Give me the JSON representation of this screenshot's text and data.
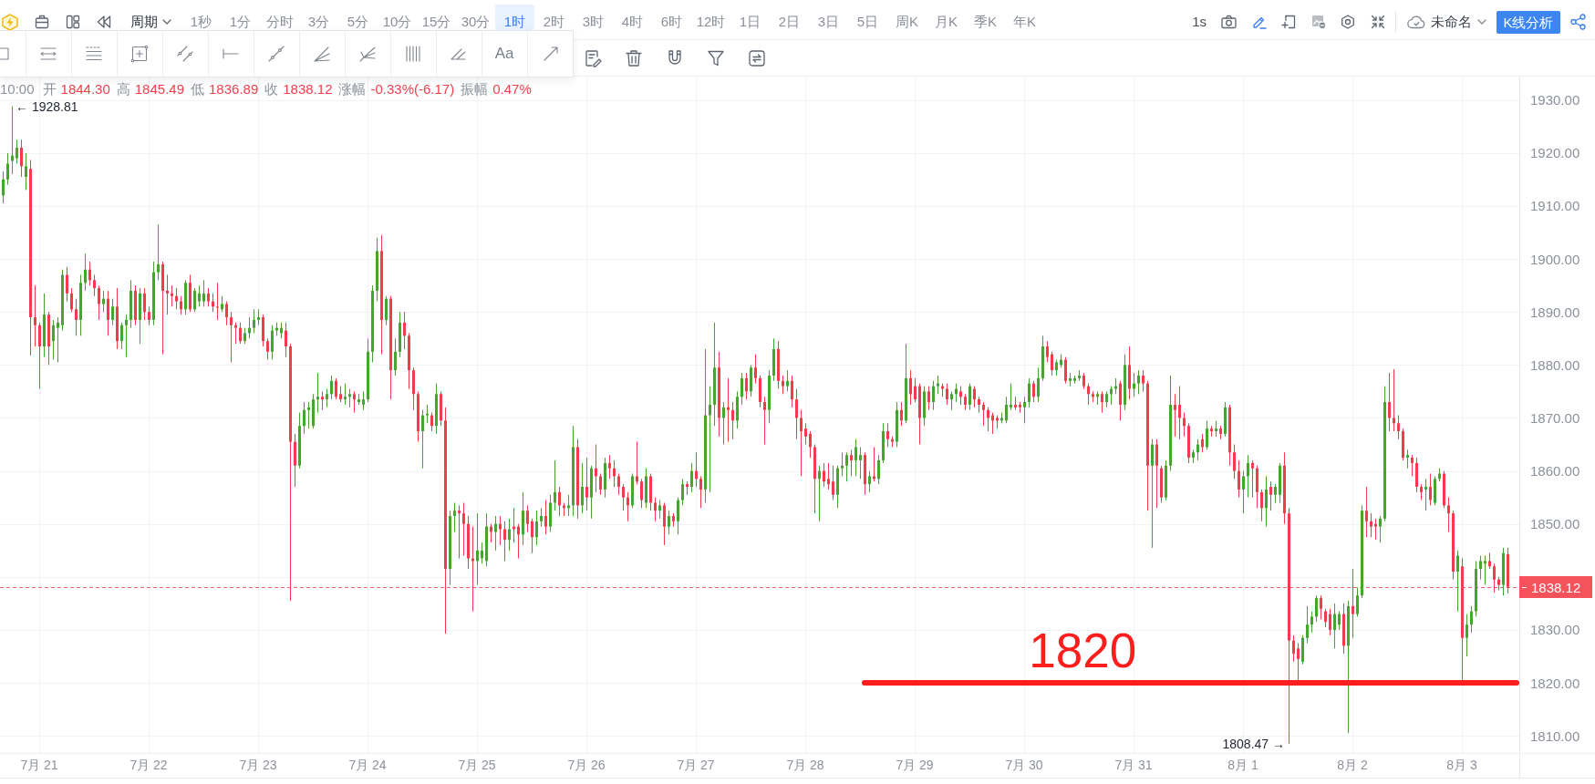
{
  "toolbar": {
    "period_menu": {
      "label": "周期"
    },
    "intervals": [
      {
        "label": "1秒",
        "selected": false
      },
      {
        "label": "1分",
        "selected": false
      },
      {
        "label": "分时",
        "selected": false
      },
      {
        "label": "3分",
        "selected": false
      },
      {
        "label": "5分",
        "selected": false
      },
      {
        "label": "10分",
        "selected": false
      },
      {
        "label": "15分",
        "selected": false
      },
      {
        "label": "30分",
        "selected": false
      },
      {
        "label": "1时",
        "selected": true
      },
      {
        "label": "2时",
        "selected": false
      },
      {
        "label": "3时",
        "selected": false
      },
      {
        "label": "4时",
        "selected": false
      },
      {
        "label": "6时",
        "selected": false
      },
      {
        "label": "12时",
        "selected": false
      },
      {
        "label": "1日",
        "selected": false
      },
      {
        "label": "2日",
        "selected": false
      },
      {
        "label": "3日",
        "selected": false
      },
      {
        "label": "5日",
        "selected": false
      },
      {
        "label": "周K",
        "selected": false
      },
      {
        "label": "月K",
        "selected": false
      },
      {
        "label": "季K",
        "selected": false
      },
      {
        "label": "年K",
        "selected": false
      }
    ],
    "refresh_rate": "1s",
    "tools": [
      {
        "active": false
      },
      {
        "active": true
      },
      {
        "active": false
      },
      {
        "active": false
      },
      {
        "active": false
      },
      {
        "active": false
      }
    ],
    "layout_name": "未命名",
    "analysis_button": "K线分析"
  },
  "drawing_toolbar": {
    "text_tool": "Aa"
  },
  "chart": {
    "header": {
      "time": "10:00",
      "fields": [
        {
          "label": "开",
          "value": "1844.30"
        },
        {
          "label": "高",
          "value": "1845.49"
        },
        {
          "label": "低",
          "value": "1836.89"
        },
        {
          "label": "收",
          "value": "1838.12"
        },
        {
          "label": "涨幅",
          "value": "-0.33%(-6.17)"
        },
        {
          "label": "振幅",
          "value": "0.47%"
        }
      ]
    },
    "chart_data": {
      "type": "candlestick",
      "grid": true,
      "ylim": [
        1806.77,
        1934.42
      ],
      "yticks": [
        {
          "value": 1930,
          "label": "1930.00"
        },
        {
          "value": 1920,
          "label": "1920.00"
        },
        {
          "value": 1910,
          "label": "1910.00"
        },
        {
          "value": 1900,
          "label": "1900.00"
        },
        {
          "value": 1890,
          "label": "1890.00"
        },
        {
          "value": 1880,
          "label": "1880.00"
        },
        {
          "value": 1870,
          "label": "1870.00"
        },
        {
          "value": 1860,
          "label": "1860.00"
        },
        {
          "value": 1850,
          "label": "1850.00"
        },
        {
          "value": 1830,
          "label": "1830.00"
        },
        {
          "value": 1820,
          "label": "1820.00"
        },
        {
          "value": 1810,
          "label": "1810.00"
        }
      ],
      "categories": [
        null,
        null,
        null,
        null,
        null,
        null,
        null,
        null,
        "7月 21",
        null,
        null,
        null,
        null,
        null,
        null,
        null,
        null,
        null,
        null,
        null,
        null,
        null,
        null,
        null,
        null,
        null,
        null,
        null,
        null,
        null,
        null,
        null,
        "7月 22",
        null,
        null,
        null,
        null,
        null,
        null,
        null,
        null,
        null,
        null,
        null,
        null,
        null,
        null,
        null,
        null,
        null,
        null,
        null,
        null,
        null,
        null,
        null,
        "7月 23",
        null,
        null,
        null,
        null,
        null,
        null,
        null,
        null,
        null,
        null,
        null,
        null,
        null,
        null,
        null,
        null,
        null,
        null,
        null,
        null,
        null,
        null,
        null,
        "7月 24",
        null,
        null,
        null,
        null,
        null,
        null,
        null,
        null,
        null,
        null,
        null,
        null,
        null,
        null,
        null,
        null,
        null,
        null,
        null,
        null,
        null,
        null,
        null,
        "7月 25",
        null,
        null,
        null,
        null,
        null,
        null,
        null,
        null,
        null,
        null,
        null,
        null,
        null,
        null,
        null,
        null,
        null,
        null,
        null,
        null,
        null,
        null,
        null,
        "7月 26",
        null,
        null,
        null,
        null,
        null,
        null,
        null,
        null,
        null,
        null,
        null,
        null,
        null,
        null,
        null,
        null,
        null,
        null,
        null,
        null,
        null,
        null,
        null,
        "7月 27",
        null,
        null,
        null,
        null,
        null,
        null,
        null,
        null,
        null,
        null,
        null,
        null,
        null,
        null,
        null,
        null,
        null,
        null,
        null,
        null,
        null,
        null,
        null,
        "7月 28",
        null,
        null,
        null,
        null,
        null,
        null,
        null,
        null,
        null,
        null,
        null,
        null,
        null,
        null,
        null,
        null,
        null,
        null,
        null,
        null,
        null,
        null,
        null,
        "7月 29",
        null,
        null,
        null,
        null,
        null,
        null,
        null,
        null,
        null,
        null,
        null,
        null,
        null,
        null,
        null,
        null,
        null,
        null,
        null,
        null,
        null,
        null,
        null,
        "7月 30",
        null,
        null,
        null,
        null,
        null,
        null,
        null,
        null,
        null,
        null,
        null,
        null,
        null,
        null,
        null,
        null,
        null,
        null,
        null,
        null,
        null,
        null,
        null,
        "7月 31",
        null,
        null,
        null,
        null,
        null,
        null,
        null,
        null,
        null,
        null,
        null,
        null,
        null,
        null,
        null,
        null,
        null,
        null,
        null,
        null,
        null,
        null,
        null,
        "8月 1",
        null,
        null,
        null,
        null,
        null,
        null,
        null,
        null,
        null,
        null,
        null,
        null,
        null,
        null,
        null,
        null,
        null,
        null,
        null,
        null,
        null,
        null,
        null,
        "8月 2",
        null,
        null,
        null,
        null,
        null,
        null,
        null,
        null,
        null,
        null,
        null,
        null,
        null,
        null,
        null,
        null,
        null,
        null,
        null,
        null,
        null,
        null,
        null,
        "8月 3",
        null,
        null,
        null,
        null,
        null,
        null,
        null,
        null,
        null,
        null
      ],
      "ohlc": [
        [
          1912,
          1916.5,
          1910.5,
          1915
        ],
        [
          1915,
          1920,
          1914,
          1918
        ],
        [
          1918.5,
          1928.81,
          1916,
          1919.5
        ],
        [
          1919,
          1922.5,
          1918,
          1921
        ],
        [
          1921,
          1922.5,
          1915.5,
          1917.5
        ],
        [
          1915.5,
          1920,
          1913,
          1917.5
        ],
        [
          1917,
          1918.7,
          1881.8,
          1889
        ],
        [
          1889,
          1895,
          1883.5,
          1887.5
        ],
        [
          1887.5,
          1888,
          1875.5,
          1883.5
        ],
        [
          1883.5,
          1893.5,
          1881.5,
          1889.5
        ],
        [
          1889.5,
          1890,
          1880,
          1883.5
        ],
        [
          1884.5,
          1888.5,
          1881,
          1887.5
        ],
        [
          1887,
          1889,
          1880.5,
          1888
        ],
        [
          1887.5,
          1898,
          1886.5,
          1897
        ],
        [
          1897,
          1898.5,
          1892,
          1893.5
        ],
        [
          1893.5,
          1894.5,
          1890,
          1890.5
        ],
        [
          1890.5,
          1892.5,
          1885.5,
          1888.5
        ],
        [
          1888.5,
          1897,
          1885.5,
          1895.5
        ],
        [
          1895.5,
          1901,
          1894,
          1898
        ],
        [
          1898,
          1899.5,
          1895,
          1896
        ],
        [
          1896,
          1897,
          1893,
          1894.5
        ],
        [
          1894.5,
          1895,
          1888.5,
          1891.5
        ],
        [
          1891.5,
          1894,
          1890,
          1892.5
        ],
        [
          1892.5,
          1894,
          1885.5,
          1888.5
        ],
        [
          1888.5,
          1892.5,
          1887.5,
          1891
        ],
        [
          1891,
          1894.5,
          1883,
          1884.5
        ],
        [
          1884.5,
          1888,
          1883,
          1887.5
        ],
        [
          1887.5,
          1889.5,
          1881.5,
          1888.5
        ],
        [
          1888.5,
          1896,
          1887,
          1894
        ],
        [
          1894,
          1895,
          1887.5,
          1888.5
        ],
        [
          1888.5,
          1894.5,
          1884,
          1893.5
        ],
        [
          1893.5,
          1894.5,
          1888.5,
          1890
        ],
        [
          1890,
          1891,
          1887.5,
          1888.5
        ],
        [
          1888.5,
          1899.5,
          1887.5,
          1897.5
        ],
        [
          1897.5,
          1906.5,
          1896,
          1899
        ],
        [
          1899,
          1899.5,
          1882,
          1894
        ],
        [
          1894,
          1897,
          1889.5,
          1893.5
        ],
        [
          1893.5,
          1895,
          1891,
          1893
        ],
        [
          1893,
          1894.5,
          1890.5,
          1892
        ],
        [
          1892,
          1893,
          1889.5,
          1890.5
        ],
        [
          1890.5,
          1896,
          1889.5,
          1895.5
        ],
        [
          1895.5,
          1897,
          1890,
          1890.5
        ],
        [
          1890.5,
          1894.5,
          1890,
          1894
        ],
        [
          1892,
          1895,
          1891,
          1893.5
        ],
        [
          1892,
          1896,
          1891,
          1893.5
        ],
        [
          1893.5,
          1894.5,
          1891,
          1892
        ],
        [
          1892,
          1893.5,
          1890,
          1891
        ],
        [
          1891,
          1895.5,
          1888.5,
          1890.8
        ],
        [
          1890.5,
          1893,
          1890,
          1891.5
        ],
        [
          1891.5,
          1892,
          1887.5,
          1889
        ],
        [
          1889,
          1890,
          1880.5,
          1887.5
        ],
        [
          1887.5,
          1888,
          1884,
          1887
        ],
        [
          1887,
          1888,
          1884,
          1884.5
        ],
        [
          1884.5,
          1887,
          1884,
          1886
        ],
        [
          1886,
          1889,
          1885,
          1887
        ],
        [
          1887,
          1890.5,
          1886,
          1888.5
        ],
        [
          1888.5,
          1890.5,
          1887.5,
          1889
        ],
        [
          1889,
          1889.5,
          1883.5,
          1884.5
        ],
        [
          1884.5,
          1885,
          1881,
          1882.5
        ],
        [
          1882.5,
          1887.5,
          1881,
          1886.5
        ],
        [
          1886.5,
          1888,
          1885.5,
          1887
        ],
        [
          1886,
          1888,
          1885,
          1887
        ],
        [
          1886.5,
          1888,
          1881.5,
          1883.5
        ],
        [
          1883.5,
          1884,
          1835.5,
          1865.5
        ],
        [
          1865.5,
          1867,
          1857,
          1861
        ],
        [
          1861,
          1871,
          1860.5,
          1868.5
        ],
        [
          1868.5,
          1873,
          1867,
          1871.5
        ],
        [
          1871.5,
          1873,
          1868,
          1872
        ],
        [
          1868.5,
          1874.5,
          1868,
          1873.5
        ],
        [
          1873.5,
          1878.5,
          1871,
          1874
        ],
        [
          1874,
          1875,
          1871.5,
          1873.5
        ],
        [
          1873.5,
          1875.5,
          1872,
          1874.5
        ],
        [
          1874.5,
          1878,
          1873.5,
          1877
        ],
        [
          1877,
          1877.5,
          1873.5,
          1874
        ],
        [
          1874.5,
          1876,
          1873,
          1873.5
        ],
        [
          1873.5,
          1876.5,
          1872.5,
          1874
        ],
        [
          1874,
          1875.5,
          1872,
          1874.5
        ],
        [
          1874.5,
          1875,
          1871,
          1873.5
        ],
        [
          1873,
          1874.5,
          1872.5,
          1873.5
        ],
        [
          1872.5,
          1875,
          1871.5,
          1873.5
        ],
        [
          1873.5,
          1885,
          1873,
          1882.5
        ],
        [
          1882.5,
          1895,
          1880.5,
          1894
        ],
        [
          1894,
          1904,
          1892,
          1901.5
        ],
        [
          1901.5,
          1904.5,
          1882,
          1888.5
        ],
        [
          1888.5,
          1893,
          1887.5,
          1892.5
        ],
        [
          1892.5,
          1893,
          1873.5,
          1879
        ],
        [
          1879,
          1885,
          1878,
          1882.5
        ],
        [
          1882.5,
          1890,
          1881.5,
          1888
        ],
        [
          1888,
          1890,
          1883,
          1885.5
        ],
        [
          1885.5,
          1886,
          1875.5,
          1879
        ],
        [
          1879,
          1879.5,
          1871.5,
          1874.5
        ],
        [
          1874.5,
          1875,
          1865.5,
          1867.5
        ],
        [
          1867.5,
          1871.5,
          1860.5,
          1870.5
        ],
        [
          1870.5,
          1872.5,
          1869,
          1870.8
        ],
        [
          1870.5,
          1871,
          1867.5,
          1868.5
        ],
        [
          1868.5,
          1876.5,
          1867,
          1874.5
        ],
        [
          1874.5,
          1875,
          1868.5,
          1869.5
        ],
        [
          1869.5,
          1872,
          1829.3,
          1841.5
        ],
        [
          1841.5,
          1852.5,
          1838.5,
          1851.5
        ],
        [
          1851.5,
          1854,
          1848.5,
          1852.5
        ],
        [
          1852.5,
          1853.5,
          1843.5,
          1852
        ],
        [
          1852,
          1854,
          1844,
          1850
        ],
        [
          1850,
          1851.5,
          1841.5,
          1843.5
        ],
        [
          1843.5,
          1849.5,
          1833.5,
          1843
        ],
        [
          1843,
          1852,
          1838.5,
          1845
        ],
        [
          1843.5,
          1846.5,
          1842.5,
          1845
        ],
        [
          1843,
          1852,
          1842,
          1849.5
        ],
        [
          1849.5,
          1850,
          1846.5,
          1848.5
        ],
        [
          1848.5,
          1851.5,
          1845,
          1850
        ],
        [
          1850,
          1851.5,
          1846,
          1849
        ],
        [
          1849,
          1850.5,
          1843,
          1847
        ],
        [
          1847,
          1851,
          1845,
          1849
        ],
        [
          1849.5,
          1853,
          1846.5,
          1849
        ],
        [
          1849.5,
          1850,
          1843.5,
          1848
        ],
        [
          1848,
          1856,
          1846,
          1852.5
        ],
        [
          1852.5,
          1853.5,
          1848.5,
          1850
        ],
        [
          1850.5,
          1851,
          1844.5,
          1847.5
        ],
        [
          1847.5,
          1852.5,
          1846,
          1850.5
        ],
        [
          1850.5,
          1853,
          1849.5,
          1851.5
        ],
        [
          1851.5,
          1854.5,
          1848,
          1849.5
        ],
        [
          1849.5,
          1855.5,
          1848.5,
          1854
        ],
        [
          1854,
          1862,
          1852.5,
          1856
        ],
        [
          1856,
          1857,
          1851.5,
          1853.5
        ],
        [
          1853.5,
          1854,
          1851.5,
          1853
        ],
        [
          1853,
          1855.5,
          1851.5,
          1853.5
        ],
        [
          1853.5,
          1868.5,
          1851.5,
          1864.5
        ],
        [
          1864.5,
          1866,
          1851,
          1853.5
        ],
        [
          1853.5,
          1861.5,
          1852,
          1857
        ],
        [
          1857,
          1862.5,
          1852.5,
          1855
        ],
        [
          1855,
          1861,
          1851,
          1860.5
        ],
        [
          1860.5,
          1865,
          1856,
          1859
        ],
        [
          1859,
          1859.5,
          1855.5,
          1856.5
        ],
        [
          1856.5,
          1862.5,
          1855,
          1861.5
        ],
        [
          1861.5,
          1863,
          1858.5,
          1860.5
        ],
        [
          1860.5,
          1862,
          1857,
          1859
        ],
        [
          1859,
          1859.5,
          1855.5,
          1857
        ],
        [
          1857,
          1857.5,
          1852.5,
          1855
        ],
        [
          1855,
          1856,
          1850.5,
          1853.5
        ],
        [
          1853.5,
          1859.5,
          1853,
          1859
        ],
        [
          1859,
          1865.5,
          1857.5,
          1858
        ],
        [
          1858,
          1858.5,
          1853,
          1854.5
        ],
        [
          1854,
          1860.5,
          1853,
          1859
        ],
        [
          1859,
          1859.5,
          1852.5,
          1854
        ],
        [
          1854,
          1855,
          1850.5,
          1852.5
        ],
        [
          1852.5,
          1854.5,
          1851,
          1853.5
        ],
        [
          1853.5,
          1854,
          1846,
          1849.5
        ],
        [
          1849.5,
          1852.5,
          1848,
          1851.5
        ],
        [
          1851.5,
          1852,
          1849.5,
          1850.5
        ],
        [
          1850.5,
          1855,
          1848,
          1854.5
        ],
        [
          1854.5,
          1858.5,
          1853.5,
          1857.5
        ],
        [
          1857.5,
          1858,
          1855.5,
          1857
        ],
        [
          1857,
          1861.5,
          1856,
          1860
        ],
        [
          1860,
          1863.5,
          1857,
          1858.5
        ],
        [
          1858.5,
          1859,
          1853,
          1856.5
        ],
        [
          1856.5,
          1883,
          1854,
          1870.5
        ],
        [
          1870.5,
          1876,
          1856,
          1872.5
        ],
        [
          1872.5,
          1888,
          1868.5,
          1879.5
        ],
        [
          1879.5,
          1882.5,
          1866.5,
          1870
        ],
        [
          1870,
          1873,
          1865,
          1872
        ],
        [
          1872,
          1877.5,
          1865.5,
          1871.5
        ],
        [
          1871.5,
          1873,
          1866,
          1869.5
        ],
        [
          1869.5,
          1875,
          1868,
          1874
        ],
        [
          1874,
          1878.5,
          1872.5,
          1877.5
        ],
        [
          1877.5,
          1878.5,
          1873.5,
          1875
        ],
        [
          1875,
          1880,
          1874,
          1879.5
        ],
        [
          1879.5,
          1882,
          1876.5,
          1877.5
        ],
        [
          1877.5,
          1878,
          1872,
          1873
        ],
        [
          1873,
          1874,
          1865,
          1871.5
        ],
        [
          1871.5,
          1879,
          1869,
          1878
        ],
        [
          1878,
          1885,
          1877,
          1883
        ],
        [
          1883,
          1884.5,
          1875.5,
          1877
        ],
        [
          1877,
          1878,
          1874.5,
          1876
        ],
        [
          1876,
          1879,
          1875,
          1877
        ],
        [
          1877,
          1878,
          1872,
          1873.5
        ],
        [
          1873.5,
          1875.5,
          1866,
          1870
        ],
        [
          1870,
          1871.5,
          1859,
          1867.5
        ],
        [
          1868,
          1869,
          1865,
          1866.5
        ],
        [
          1867,
          1867.5,
          1862.5,
          1864.5
        ],
        [
          1864.5,
          1865,
          1852,
          1858.5
        ],
        [
          1858.5,
          1861,
          1850.5,
          1860
        ],
        [
          1860,
          1861.5,
          1857,
          1858
        ],
        [
          1858.5,
          1861.5,
          1856.5,
          1857.5
        ],
        [
          1858,
          1861,
          1854.5,
          1855.5
        ],
        [
          1855.5,
          1861,
          1853,
          1860.5
        ],
        [
          1860.5,
          1863.5,
          1859,
          1861
        ],
        [
          1861,
          1863.5,
          1858,
          1863
        ],
        [
          1863,
          1864,
          1859,
          1862
        ],
        [
          1862,
          1866,
          1859,
          1864.5
        ],
        [
          1862,
          1864.5,
          1858.5,
          1863
        ],
        [
          1863,
          1863.5,
          1855.5,
          1857.5
        ],
        [
          1857.5,
          1860,
          1856,
          1859
        ],
        [
          1859,
          1864.5,
          1858,
          1858.5
        ],
        [
          1858.5,
          1863,
          1857.5,
          1862
        ],
        [
          1862,
          1869,
          1861.5,
          1867.5
        ],
        [
          1867.5,
          1869,
          1864.5,
          1866
        ],
        [
          1866,
          1866.5,
          1864.5,
          1865.5
        ],
        [
          1865.5,
          1873,
          1864.5,
          1871.5
        ],
        [
          1871.5,
          1873,
          1868.5,
          1869.5
        ],
        [
          1869.5,
          1884,
          1869,
          1877.5
        ],
        [
          1877.5,
          1879,
          1872.5,
          1874.5
        ],
        [
          1876,
          1877.5,
          1873,
          1873.5
        ],
        [
          1876,
          1876.5,
          1865,
          1870
        ],
        [
          1870,
          1876,
          1868.5,
          1875
        ],
        [
          1875,
          1876,
          1871.5,
          1873
        ],
        [
          1873,
          1877,
          1871.5,
          1876
        ],
        [
          1876,
          1878,
          1874.5,
          1876.5
        ],
        [
          1876,
          1876.5,
          1874,
          1875.5
        ],
        [
          1875.5,
          1876.5,
          1872.5,
          1873.5
        ],
        [
          1873.5,
          1875,
          1871.5,
          1874.5
        ],
        [
          1874.5,
          1876.5,
          1873,
          1875.5
        ],
        [
          1875,
          1876,
          1872.5,
          1874
        ],
        [
          1874,
          1874.5,
          1871.5,
          1872.5
        ],
        [
          1872.5,
          1876.5,
          1871.5,
          1876
        ],
        [
          1875.5,
          1876,
          1872,
          1873.5
        ],
        [
          1873.5,
          1874,
          1871,
          1872.5
        ],
        [
          1872.5,
          1873,
          1868.5,
          1871.5
        ],
        [
          1871.5,
          1872,
          1867.5,
          1870
        ],
        [
          1870.5,
          1871,
          1867,
          1869.5
        ],
        [
          1870,
          1870.5,
          1868,
          1869.5
        ],
        [
          1869.5,
          1871,
          1869,
          1870
        ],
        [
          1869.5,
          1874,
          1869,
          1872.5
        ],
        [
          1872,
          1876.5,
          1871.5,
          1872.5
        ],
        [
          1872.5,
          1874,
          1871.5,
          1872
        ],
        [
          1872.5,
          1873,
          1871,
          1872
        ],
        [
          1872,
          1874,
          1869,
          1873
        ],
        [
          1873,
          1877.5,
          1872,
          1876.5
        ],
        [
          1876.5,
          1877,
          1873,
          1874
        ],
        [
          1874,
          1879.5,
          1873,
          1877.5
        ],
        [
          1877.5,
          1885.5,
          1877,
          1883.5
        ],
        [
          1883.5,
          1884.5,
          1880.5,
          1881.5
        ],
        [
          1882,
          1882.5,
          1878,
          1879
        ],
        [
          1879,
          1881,
          1878,
          1880.5
        ],
        [
          1880,
          1882,
          1879.5,
          1881
        ],
        [
          1881,
          1881.5,
          1876.5,
          1877
        ],
        [
          1877,
          1878.5,
          1876,
          1877.5
        ],
        [
          1877,
          1878,
          1876.5,
          1877.5
        ],
        [
          1877.5,
          1879,
          1877,
          1878
        ],
        [
          1878,
          1878.5,
          1875.5,
          1876
        ],
        [
          1876,
          1876.5,
          1872.5,
          1874.5
        ],
        [
          1874.5,
          1875,
          1873,
          1874
        ],
        [
          1874,
          1875,
          1872.5,
          1874.5
        ],
        [
          1874.5,
          1875,
          1871,
          1873
        ],
        [
          1873,
          1875,
          1872,
          1874.5
        ],
        [
          1874.5,
          1876,
          1872.5,
          1875.5
        ],
        [
          1875.5,
          1877.5,
          1874.5,
          1876
        ],
        [
          1876.5,
          1877,
          1869.5,
          1872.5
        ],
        [
          1872.5,
          1882,
          1871.5,
          1880
        ],
        [
          1880,
          1883.5,
          1873.5,
          1875.5
        ],
        [
          1875.5,
          1878.5,
          1874,
          1876.5
        ],
        [
          1876.5,
          1879,
          1874.5,
          1878
        ],
        [
          1878,
          1879,
          1875,
          1876.5
        ],
        [
          1876.5,
          1877,
          1852.5,
          1861
        ],
        [
          1861,
          1866,
          1845.5,
          1865
        ],
        [
          1865,
          1866,
          1853,
          1861
        ],
        [
          1860.5,
          1861,
          1854,
          1855
        ],
        [
          1855,
          1862,
          1854.5,
          1861
        ],
        [
          1861,
          1878,
          1860,
          1872.5
        ],
        [
          1872.5,
          1874.5,
          1866.5,
          1871.5
        ],
        [
          1872.5,
          1876,
          1866,
          1870
        ],
        [
          1870,
          1871,
          1866.5,
          1868.5
        ],
        [
          1868.5,
          1869,
          1861.5,
          1862.5
        ],
        [
          1862.5,
          1864,
          1861.5,
          1863.5
        ],
        [
          1863.5,
          1866,
          1862,
          1865
        ],
        [
          1866,
          1867,
          1863.5,
          1864.5
        ],
        [
          1864.5,
          1869.5,
          1864,
          1868
        ],
        [
          1868,
          1868.5,
          1866.5,
          1867.5
        ],
        [
          1867.5,
          1869.5,
          1866.5,
          1868
        ],
        [
          1868,
          1868.5,
          1866,
          1867
        ],
        [
          1867,
          1873,
          1866.5,
          1872
        ],
        [
          1872,
          1872.5,
          1861,
          1863.5
        ],
        [
          1863.5,
          1865,
          1858.5,
          1860
        ],
        [
          1860,
          1862,
          1855,
          1856.5
        ],
        [
          1856.5,
          1860,
          1852,
          1859
        ],
        [
          1859,
          1863,
          1855,
          1861.5
        ],
        [
          1861.5,
          1862,
          1855,
          1860.5
        ],
        [
          1860.5,
          1861,
          1853,
          1856
        ],
        [
          1856,
          1856.5,
          1850.5,
          1853
        ],
        [
          1853,
          1859,
          1849.5,
          1856.5
        ],
        [
          1857,
          1858,
          1852.5,
          1855.5
        ],
        [
          1855.5,
          1857.5,
          1854,
          1857
        ],
        [
          1855.5,
          1861.5,
          1854,
          1861
        ],
        [
          1861,
          1863.5,
          1850,
          1852
        ],
        [
          1852,
          1853,
          1808.47,
          1828
        ],
        [
          1828,
          1829,
          1824,
          1825.5
        ],
        [
          1826.5,
          1827.5,
          1820,
          1824.5
        ],
        [
          1824,
          1829,
          1823.5,
          1828.5
        ],
        [
          1828.5,
          1834.5,
          1827.5,
          1831
        ],
        [
          1831,
          1833.5,
          1829.5,
          1832.5
        ],
        [
          1832.5,
          1836.5,
          1831.5,
          1836
        ],
        [
          1836,
          1836.5,
          1832,
          1834
        ],
        [
          1833.5,
          1834,
          1830.5,
          1831.5
        ],
        [
          1833,
          1834,
          1829,
          1830
        ],
        [
          1830,
          1835,
          1826.5,
          1833
        ],
        [
          1831,
          1833.5,
          1830,
          1833
        ],
        [
          1833,
          1835,
          1825.5,
          1827
        ],
        [
          1827,
          1835.5,
          1810.5,
          1834.5
        ],
        [
          1834.5,
          1841.5,
          1828.5,
          1833
        ],
        [
          1833,
          1838,
          1832.5,
          1836.5
        ],
        [
          1836.5,
          1853.5,
          1836,
          1852.5
        ],
        [
          1852.5,
          1857,
          1847.5,
          1850.5
        ],
        [
          1850.5,
          1852,
          1847.5,
          1849.5
        ],
        [
          1850,
          1851,
          1847,
          1849.5
        ],
        [
          1849.5,
          1851.5,
          1846.5,
          1851
        ],
        [
          1851,
          1876,
          1850.5,
          1873
        ],
        [
          1873,
          1878.5,
          1867.5,
          1870
        ],
        [
          1870,
          1879.19,
          1867.5,
          1869
        ],
        [
          1869,
          1870.5,
          1866,
          1867.5
        ],
        [
          1867.5,
          1868,
          1862,
          1862.5
        ],
        [
          1862.5,
          1864,
          1860.5,
          1863
        ],
        [
          1862.5,
          1863,
          1859,
          1861.5
        ],
        [
          1861.5,
          1862.5,
          1856,
          1857
        ],
        [
          1857,
          1857.5,
          1854.5,
          1856
        ],
        [
          1856.5,
          1858.5,
          1852.5,
          1857
        ],
        [
          1857,
          1859.5,
          1853.5,
          1854.5
        ],
        [
          1854,
          1859,
          1853.5,
          1858.5
        ],
        [
          1858.5,
          1860.5,
          1858,
          1859.5
        ],
        [
          1859.5,
          1860,
          1853,
          1853.5
        ],
        [
          1853.5,
          1855,
          1848.5,
          1852
        ],
        [
          1852,
          1852.5,
          1839.5,
          1841
        ],
        [
          1841,
          1845,
          1833.5,
          1844
        ],
        [
          1842,
          1843.5,
          1820.2,
          1828.5
        ],
        [
          1828.5,
          1833,
          1825,
          1831
        ],
        [
          1831,
          1834.5,
          1829.5,
          1833.5
        ],
        [
          1833.5,
          1843,
          1832.5,
          1841.5
        ],
        [
          1841.5,
          1844,
          1839.5,
          1843
        ],
        [
          1842.5,
          1844,
          1838.5,
          1843
        ],
        [
          1843,
          1844.5,
          1841.5,
          1842
        ],
        [
          1842,
          1842.5,
          1837,
          1839.5
        ],
        [
          1839.5,
          1840,
          1837.5,
          1838.5
        ],
        [
          1838.5,
          1845.5,
          1836.5,
          1844.5
        ],
        [
          1844.3,
          1845.49,
          1836.89,
          1838.12
        ]
      ],
      "annotations": [
        "← 1928.81",
        "1808.47 →"
      ],
      "ref_lines": [
        {
          "axis": "y",
          "value": 1838.12,
          "label": "1838.12"
        },
        {
          "axis": "y",
          "value": 1820,
          "label": "1820"
        }
      ]
    }
  }
}
